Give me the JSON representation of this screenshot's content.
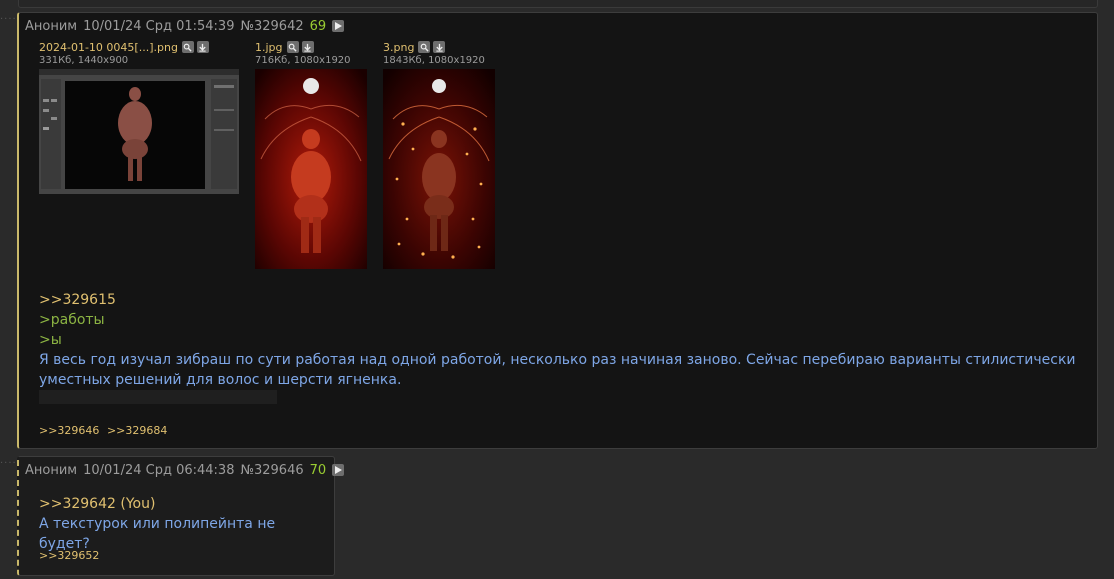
{
  "posts": [
    {
      "author": "Аноним",
      "date": "10/01/24 Срд 01:54:39",
      "number": "№329642",
      "reply_count": "69",
      "files": [
        {
          "name": "2024-01-10 0045[...].png",
          "meta": "331Кб, 1440x900"
        },
        {
          "name": "1.jpg",
          "meta": "716Кб, 1080x1920"
        },
        {
          "name": "3.png",
          "meta": "1843Кб, 1080x1920"
        }
      ],
      "body": {
        "reply_ref": ">>329615",
        "quote1": ">работы",
        "quote2": ">ы",
        "text": "Я весь год изучал зибраш по сути работая над одной работой, несколько раз начиная заново. Сейчас перебираю варианты стилистически уместных решений для волос и шерсти ягненка."
      },
      "backlinks": [
        ">>329646",
        ">>329684"
      ]
    },
    {
      "author": "Аноним",
      "date": "10/01/24 Срд 06:44:38",
      "number": "№329646",
      "reply_count": "70",
      "body": {
        "reply_ref": ">>329642 (You)",
        "text": "А текстурок или полипейнта не будет?"
      },
      "backlinks": [
        ">>329652"
      ]
    }
  ],
  "colors": {
    "background": "#2a2a2a",
    "post_bg": "#141414",
    "link": "#e0c070",
    "quote": "#8cb443",
    "text": "#7ea6e6",
    "reply_count": "#9acd32",
    "highlight_border": "#c9b86a"
  },
  "icons": {
    "play": "play-icon",
    "zoom": "magnifier-icon",
    "download": "download-icon"
  }
}
